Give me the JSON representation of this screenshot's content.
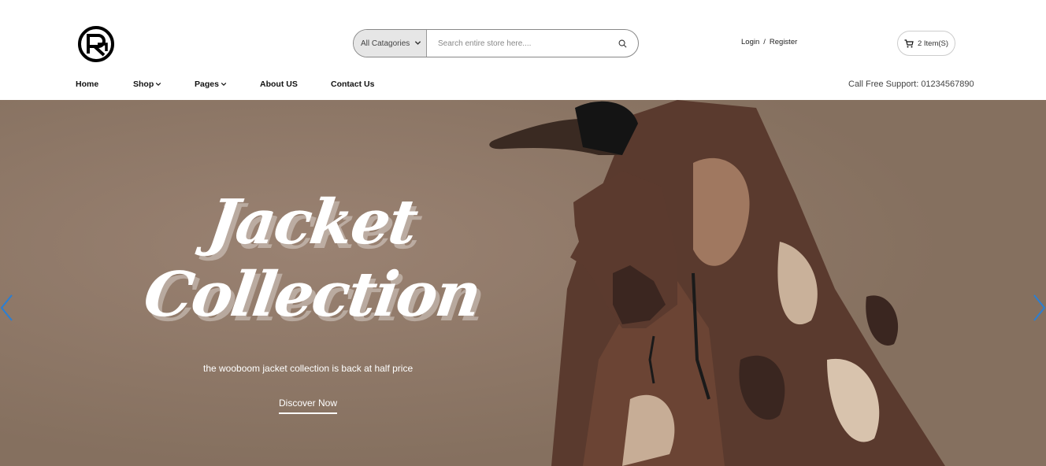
{
  "header": {
    "logo_alt": "RG",
    "search": {
      "category_selected": "All Catagories",
      "placeholder": "Search entire store here...."
    },
    "auth": {
      "login": "Login",
      "separator": "/",
      "register": "Register"
    },
    "cart": {
      "label": "2 Item(S)"
    }
  },
  "nav": {
    "items": [
      {
        "label": "Home"
      },
      {
        "label": "Shop"
      },
      {
        "label": "Pages"
      },
      {
        "label": "About US"
      },
      {
        "label": "Contact Us"
      }
    ],
    "support": "Call Free Support: 01234567890"
  },
  "hero": {
    "title_line1": "Jacket",
    "title_line2": "Collection",
    "subtitle": "the wooboom jacket collection is back at half price",
    "cta": "Discover Now"
  },
  "colors": {
    "hero_bg": "#8b7566",
    "accent_arrow": "#2a7fd4"
  }
}
